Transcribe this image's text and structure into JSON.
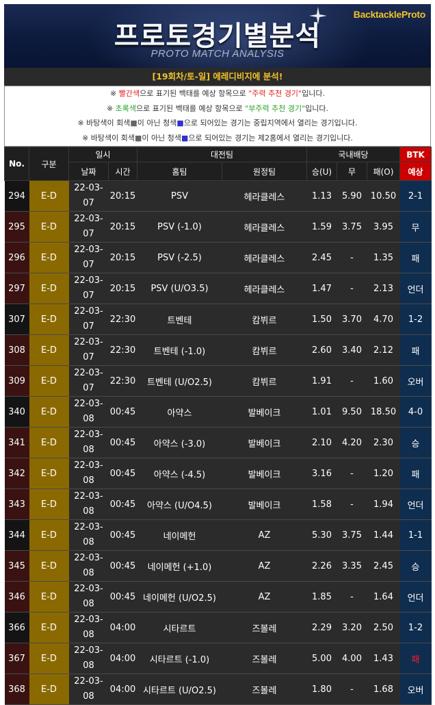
{
  "banner": {
    "brand": "BacktackleProto",
    "title": "프로토경기별분석",
    "subtitle": "PROTO MATCH ANALYSIS",
    "round": "[19회차/토-일] 에레디비지에 분석!"
  },
  "notes": [
    {
      "pre": "※ ",
      "c1": "빨간색",
      "mid": "으로 표기된 백태를 예상 항목으로 ",
      "c2": "\"주력 추천 경기\"",
      "post": "입니다.",
      "color": "red"
    },
    {
      "pre": "※ ",
      "c1": "초록색",
      "mid": "으로 표기된 백태를 예상 항목으로 ",
      "c2": "\"부주력 추천 경기\"",
      "post": "입니다.",
      "color": "green"
    },
    {
      "pre": "※ 바탕색이 회색",
      "c1": "■",
      "mid": "이 아닌 청색",
      "c2": "■",
      "post": "으로 되어있는 경기는 중립지역에서 열리는 경기입니다.",
      "color": "mixed"
    },
    {
      "pre": "※ 바탕색이 회색",
      "c1": "■",
      "mid": "이 아닌 청색",
      "c2": "■",
      "post": "으로 되어있는 경기는 제2홈에서 열리는 경기입니다.",
      "color": "mixed"
    }
  ],
  "table": {
    "headers": {
      "no": "No.",
      "cat": "구분",
      "datetime": "일시",
      "date": "날짜",
      "time": "시간",
      "matchup": "대전팀",
      "home": "홈팀",
      "away": "원정팀",
      "odds": "국내배당",
      "win": "승(U)",
      "draw": "무",
      "lose": "패(O)",
      "btk1": "BTK",
      "btk2": "예상"
    },
    "rows": [
      {
        "no": "294",
        "cat": "E-D",
        "date1": "22-03-",
        "date2": "07",
        "time": "20:15",
        "home": "PSV",
        "away": "헤라클레스",
        "w": "1.13",
        "d": "5.90",
        "l": "10.50",
        "pred": "2-1",
        "hl": false,
        "red": false
      },
      {
        "no": "295",
        "cat": "E-D",
        "date1": "22-03-",
        "date2": "07",
        "time": "20:15",
        "home": "PSV (-1.0)",
        "away": "헤라클레스",
        "w": "1.59",
        "d": "3.75",
        "l": "3.95",
        "pred": "무",
        "hl": false,
        "red": true
      },
      {
        "no": "296",
        "cat": "E-D",
        "date1": "22-03-",
        "date2": "07",
        "time": "20:15",
        "home": "PSV (-2.5)",
        "away": "헤라클레스",
        "w": "2.45",
        "d": "-",
        "l": "1.35",
        "pred": "패",
        "hl": false,
        "red": true
      },
      {
        "no": "297",
        "cat": "E-D",
        "date1": "22-03-",
        "date2": "07",
        "time": "20:15",
        "home": "PSV (U/O3.5)",
        "away": "헤라클레스",
        "w": "1.47",
        "d": "-",
        "l": "2.13",
        "pred": "언더",
        "hl": false,
        "red": true
      },
      {
        "no": "307",
        "cat": "E-D",
        "date1": "22-03-",
        "date2": "07",
        "time": "22:30",
        "home": "트벤테",
        "away": "캄뷔르",
        "w": "1.50",
        "d": "3.70",
        "l": "4.70",
        "pred": "1-2",
        "hl": false,
        "red": false
      },
      {
        "no": "308",
        "cat": "E-D",
        "date1": "22-03-",
        "date2": "07",
        "time": "22:30",
        "home": "트벤테 (-1.0)",
        "away": "캄뷔르",
        "w": "2.60",
        "d": "3.40",
        "l": "2.12",
        "pred": "패",
        "hl": false,
        "red": true
      },
      {
        "no": "309",
        "cat": "E-D",
        "date1": "22-03-",
        "date2": "07",
        "time": "22:30",
        "home": "트벤테 (U/O2.5)",
        "away": "캄뷔르",
        "w": "1.91",
        "d": "-",
        "l": "1.60",
        "pred": "오버",
        "hl": false,
        "red": true
      },
      {
        "no": "340",
        "cat": "E-D",
        "date1": "22-03-",
        "date2": "08",
        "time": "00:45",
        "home": "아약스",
        "away": "발베이크",
        "w": "1.01",
        "d": "9.50",
        "l": "18.50",
        "pred": "4-0",
        "hl": false,
        "red": false
      },
      {
        "no": "341",
        "cat": "E-D",
        "date1": "22-03-",
        "date2": "08",
        "time": "00:45",
        "home": "아약스 (-3.0)",
        "away": "발베이크",
        "w": "2.10",
        "d": "4.20",
        "l": "2.30",
        "pred": "승",
        "hl": false,
        "red": true
      },
      {
        "no": "342",
        "cat": "E-D",
        "date1": "22-03-",
        "date2": "08",
        "time": "00:45",
        "home": "아약스 (-4.5)",
        "away": "발베이크",
        "w": "3.16",
        "d": "-",
        "l": "1.20",
        "pred": "패",
        "hl": false,
        "red": true
      },
      {
        "no": "343",
        "cat": "E-D",
        "date1": "22-03-",
        "date2": "08",
        "time": "00:45",
        "home": "아약스 (U/O4.5)",
        "away": "발베이크",
        "w": "1.58",
        "d": "-",
        "l": "1.94",
        "pred": "언더",
        "hl": false,
        "red": true
      },
      {
        "no": "344",
        "cat": "E-D",
        "date1": "22-03-",
        "date2": "08",
        "time": "00:45",
        "home": "네이메헌",
        "away": "AZ",
        "w": "5.30",
        "d": "3.75",
        "l": "1.44",
        "pred": "1-1",
        "hl": false,
        "red": false
      },
      {
        "no": "345",
        "cat": "E-D",
        "date1": "22-03-",
        "date2": "08",
        "time": "00:45",
        "home": "네이메헌 (+1.0)",
        "away": "AZ",
        "w": "2.26",
        "d": "3.35",
        "l": "2.45",
        "pred": "승",
        "hl": false,
        "red": true
      },
      {
        "no": "346",
        "cat": "E-D",
        "date1": "22-03-",
        "date2": "08",
        "time": "00:45",
        "home": "네이메헌 (U/O2.5)",
        "away": "AZ",
        "w": "1.85",
        "d": "-",
        "l": "1.64",
        "pred": "언더",
        "hl": false,
        "red": true
      },
      {
        "no": "366",
        "cat": "E-D",
        "date1": "22-03-",
        "date2": "08",
        "time": "04:00",
        "home": "시타르트",
        "away": "즈볼레",
        "w": "2.29",
        "d": "3.20",
        "l": "2.50",
        "pred": "1-2",
        "hl": false,
        "red": false
      },
      {
        "no": "367",
        "cat": "E-D",
        "date1": "22-03-",
        "date2": "08",
        "time": "04:00",
        "home": "시타르트 (-1.0)",
        "away": "즈볼레",
        "w": "5.00",
        "d": "4.00",
        "l": "1.43",
        "pred": "패",
        "hl": true,
        "red": true
      },
      {
        "no": "368",
        "cat": "E-D",
        "date1": "22-03-",
        "date2": "08",
        "time": "04:00",
        "home": "시타르트 (U/O2.5)",
        "away": "즈볼레",
        "w": "1.80",
        "d": "-",
        "l": "1.68",
        "pred": "오버",
        "hl": false,
        "red": true
      }
    ]
  }
}
